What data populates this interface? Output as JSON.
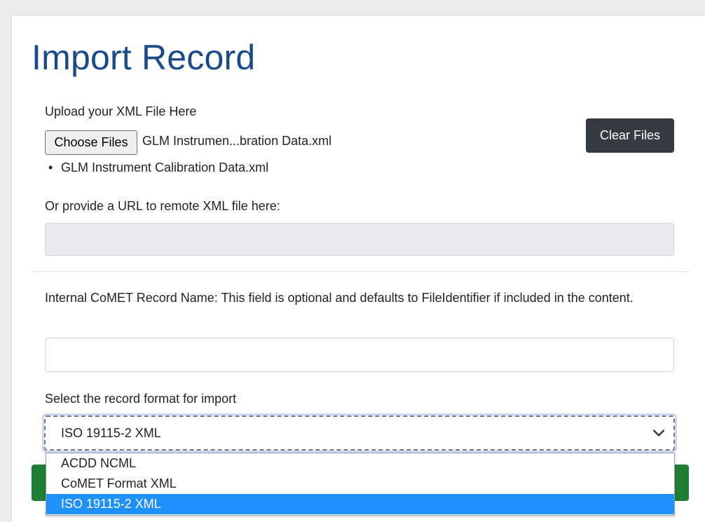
{
  "page": {
    "title": "Import Record"
  },
  "upload": {
    "label": "Upload your XML File Here",
    "choose_button": "Choose Files",
    "selected_file_display": "GLM Instrumen...bration Data.xml",
    "clear_button": "Clear Files",
    "files": [
      "GLM Instrument Calibration Data.xml"
    ]
  },
  "url": {
    "label": "Or provide a URL to remote XML file here:",
    "value": ""
  },
  "record_name": {
    "label": "Internal CoMET Record Name: This field is optional and defaults to FileIdentifier if included in the content.",
    "value": ""
  },
  "format": {
    "label": "Select the record format for import",
    "selected": "ISO 19115-2 XML",
    "options": [
      "ACDD NCML",
      "CoMET Format XML",
      "ISO 19115-2 XML"
    ],
    "selected_index": 2
  },
  "icons": {
    "select_arrow": "chevron-down-icon"
  },
  "colors": {
    "title": "#1a4a8a",
    "clear_button": "#343a40",
    "highlight": "#1e90ff",
    "submit_green": "#1e7e34"
  }
}
